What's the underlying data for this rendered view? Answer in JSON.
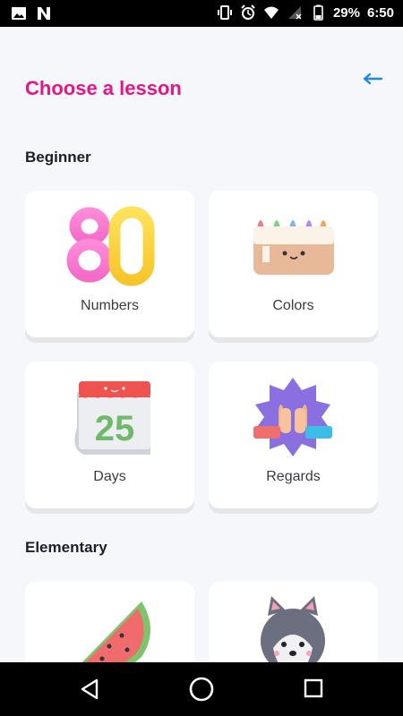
{
  "status_bar": {
    "battery_percent": "29%",
    "time": "6:50",
    "icons": [
      "image-icon",
      "n-app-icon",
      "vibrate-icon",
      "alarm-icon",
      "wifi-icon",
      "signal-icon",
      "battery-icon"
    ]
  },
  "header": {
    "back_icon": "arrow-left-icon",
    "title": "Choose a lesson"
  },
  "sections": [
    {
      "title": "Beginner",
      "lessons": [
        {
          "label": "Numbers",
          "icon": "numbers-80-icon"
        },
        {
          "label": "Colors",
          "icon": "crayon-box-icon"
        },
        {
          "label": "Days",
          "icon": "calendar-25-icon",
          "icon_text": "25"
        },
        {
          "label": "Regards",
          "icon": "high-five-badge-icon"
        }
      ]
    },
    {
      "title": "Elementary",
      "lessons": [
        {
          "label": "",
          "icon": "watermelon-icon"
        },
        {
          "label": "",
          "icon": "husky-dog-icon"
        }
      ]
    }
  ],
  "numbers_art_text": "80",
  "nav_bar": {
    "icons": [
      "back-triangle-icon",
      "home-circle-icon",
      "recents-square-icon"
    ]
  },
  "colors": {
    "accent": "#e0168a",
    "link": "#1e88e5",
    "background": "#f6f7fb"
  }
}
